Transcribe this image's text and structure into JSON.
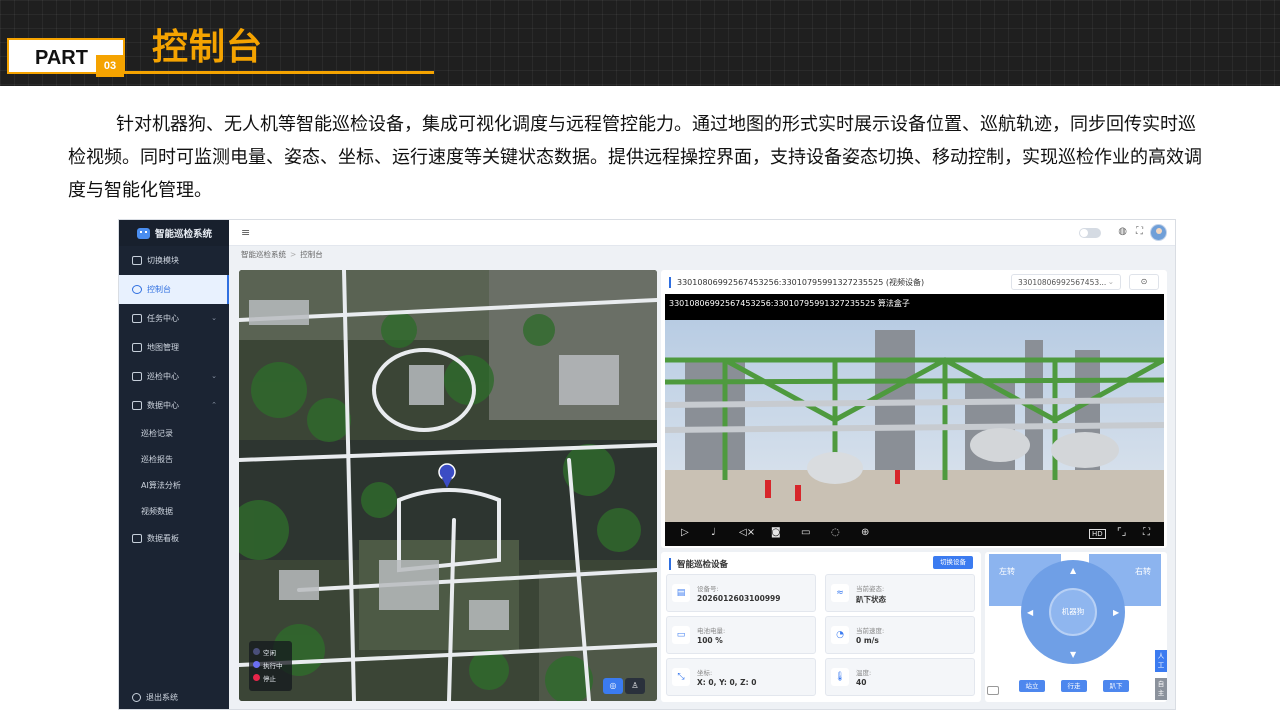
{
  "slide": {
    "part_label": "PART",
    "part_number": "03",
    "title": "控制台",
    "description": "针对机器狗、无人机等智能巡检设备，集成可视化调度与远程管控能力。通过地图的形式实时展示设备位置、巡航轨迹，同步回传实时巡检视频。同时可监测电量、姿态、坐标、运行速度等关键状态数据。提供远程操控界面，支持设备姿态切换、移动控制，实现巡检作业的高效调度与智能化管理。",
    "accent_color": "#f5a300"
  },
  "app": {
    "logo_text": "智能巡检系统",
    "sidebar": {
      "items": [
        {
          "label": "切换模块",
          "icon": "grid-icon"
        },
        {
          "label": "控制台",
          "icon": "target-icon",
          "active": true
        },
        {
          "label": "任务中心",
          "icon": "calendar-icon"
        },
        {
          "label": "地图管理",
          "icon": "map-icon"
        },
        {
          "label": "巡检中心",
          "icon": "list-icon"
        },
        {
          "label": "数据中心",
          "icon": "data-icon"
        }
      ],
      "sub_items": [
        "巡检记录",
        "巡检报告",
        "AI算法分析",
        "视频数据"
      ],
      "dashboard": "数据看板",
      "logout": "退出系统"
    },
    "breadcrumb": [
      "智能巡检系统",
      "控制台"
    ],
    "map": {
      "legend": [
        {
          "label": "空闲",
          "color": "#4a4f7a"
        },
        {
          "label": "执行中",
          "color": "#6b6ff2"
        },
        {
          "label": "停止",
          "color": "#e8254a"
        }
      ]
    },
    "video": {
      "title": "33010806992567453256:33010795991327235525 (视频设备)",
      "select_value": "33010806992567453...",
      "caption": "33010806992567453256:33010795991327235525   算法盒子",
      "hd_label": "HD"
    },
    "device": {
      "title": "智能巡检设备",
      "switch_button": "切换设备",
      "cards": [
        {
          "key": "设备号:",
          "value": "2026012603100999",
          "icon": "device-icon"
        },
        {
          "key": "当前姿态:",
          "value": "趴下状态",
          "icon": "posture-icon"
        },
        {
          "key": "电池电量:",
          "value": "100 %",
          "icon": "battery-icon"
        },
        {
          "key": "当前速度:",
          "value": "0 m/s",
          "icon": "speed-icon"
        },
        {
          "key": "坐标:",
          "value": "X: 0, Y: 0, Z: 0",
          "icon": "coordinate-icon"
        },
        {
          "key": "温度:",
          "value": "40",
          "icon": "thermometer-icon"
        }
      ]
    },
    "control": {
      "turn_left": "左转",
      "turn_right": "右转",
      "center": "机器狗",
      "buttons": [
        "站立",
        "行走",
        "趴下"
      ],
      "side_tabs": [
        "人工",
        "自主"
      ]
    }
  }
}
